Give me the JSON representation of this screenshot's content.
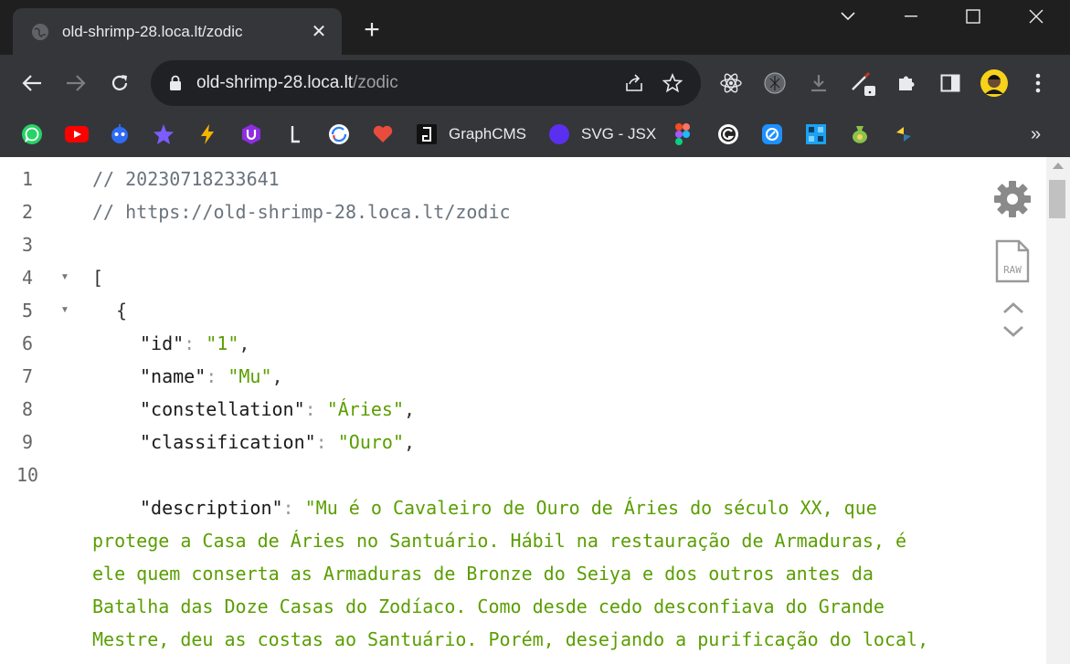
{
  "tab": {
    "title": "old-shrimp-28.loca.lt/zodic",
    "close_glyph": "✕",
    "new_tab_glyph": "+"
  },
  "address": {
    "host": "old-shrimp-28.loca.lt",
    "path": "/zodic"
  },
  "bookmarks": [
    {
      "name": "whatsapp",
      "label": "",
      "color": "#25d366"
    },
    {
      "name": "youtube",
      "label": "",
      "color": "#ff0000"
    },
    {
      "name": "robot",
      "label": "",
      "color": "#2f6cf6"
    },
    {
      "name": "star",
      "label": "",
      "color": "#6c5ce7"
    },
    {
      "name": "bolt",
      "label": "",
      "color": "#f5b300"
    },
    {
      "name": "u-logo",
      "label": "",
      "color": "#8e2de2"
    },
    {
      "name": "l-logo",
      "label": "",
      "color": "#333333"
    },
    {
      "name": "sync",
      "label": "",
      "color": "#2d7ff9"
    },
    {
      "name": "heart",
      "label": "",
      "color": "#e74c3c"
    },
    {
      "name": "graphcms",
      "label": "GraphCMS",
      "color": "#111111"
    },
    {
      "name": "svg-jsx",
      "label": "SVG - JSX",
      "color": "#5b2ff0"
    },
    {
      "name": "figma",
      "label": "",
      "color": "#f24e1e"
    },
    {
      "name": "g-logo",
      "label": "",
      "color": "#222222"
    },
    {
      "name": "compass",
      "label": "",
      "color": "#1e90ff"
    },
    {
      "name": "grid",
      "label": "",
      "color": "#1da1f2"
    },
    {
      "name": "money-bag",
      "label": "",
      "color": "#8bc34a"
    },
    {
      "name": "python",
      "label": "",
      "color": "#ffd43b"
    }
  ],
  "bookmarks_overflow": "»",
  "editor": {
    "line_numbers": [
      "1",
      "2",
      "3",
      "4",
      "5",
      "6",
      "7",
      "8",
      "9",
      "10"
    ],
    "fold_markers": [
      "▼",
      "▼"
    ],
    "lines": {
      "l1": "// 20230718233641",
      "l2": "// https://old-shrimp-28.loca.lt/zodic",
      "l4": "[",
      "l5": "{",
      "id_key": "\"id\"",
      "id_val": "\"1\"",
      "name_key": "\"name\"",
      "name_val": "\"Mu\"",
      "const_key": "\"constellation\"",
      "const_val": "\"Áries\"",
      "class_key": "\"classification\"",
      "class_val": "\"Ouro\"",
      "desc_key": "\"description\"",
      "colon": ":",
      "comma": ","
    },
    "description": "\"Mu é o Cavaleiro de Ouro de Áries do século XX, que protege a Casa de Áries no Santuário. Hábil na restauração de Armaduras, é ele quem conserta as Armaduras de Bronze do Seiya e dos outros antes da Batalha das Doze Casas do Zodíaco. Como desde cedo desconfiava do Grande Mestre, deu as costas ao Santuário. Porém, desejando a purificação do local, manteve suas obrigações como"
  }
}
